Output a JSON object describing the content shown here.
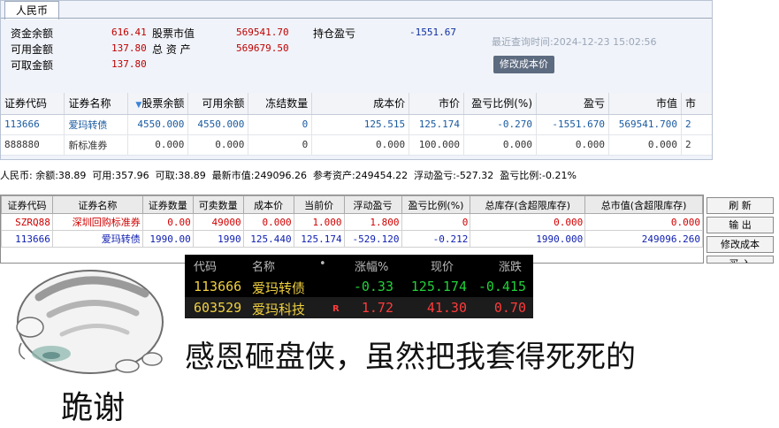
{
  "panel1": {
    "tab": "人民币",
    "summary": {
      "cash_balance": {
        "label": "资金余额",
        "value": "616.41"
      },
      "available": {
        "label": "可用金额",
        "value": "137.80"
      },
      "withdrawable": {
        "label": "可取金额",
        "value": "137.80"
      },
      "stock_value": {
        "label": "股票市值",
        "value": "569541.70"
      },
      "total_assets": {
        "label": "总 资 产",
        "value": "569679.50"
      },
      "position_pnl": {
        "label": "持仓盈亏",
        "value": "-1551.67"
      }
    },
    "last_query": "最近查询时间:2024-12-23 15:02:56",
    "modify_cost_btn": "修改成本价",
    "columns": [
      "证券代码",
      "证券名称",
      "股票余额",
      "可用余额",
      "冻结数量",
      "成本价",
      "市价",
      "盈亏比例(%)",
      "盈亏",
      "市值",
      "市"
    ],
    "rows": [
      [
        "113666",
        "爱玛转债",
        "4550.000",
        "4550.000",
        "0",
        "125.515",
        "125.174",
        "-0.270",
        "-1551.670",
        "569541.700",
        "2"
      ],
      [
        "888880",
        "新标准券",
        "0.000",
        "0.000",
        "0",
        "0.000",
        "100.000",
        "0.000",
        "0.000",
        "0.000",
        "2"
      ]
    ]
  },
  "panel2": {
    "summary": "人民币: 余额:38.89  可用:357.96  可取:38.89  最新市值:249096.26  参考资产:249454.22  浮动盈亏:-527.32  盈亏比例:-0.21%",
    "columns": [
      "证券代码",
      "证券名称",
      "证券数量",
      "可卖数量",
      "成本价",
      "当前价",
      "浮动盈亏",
      "盈亏比例(%)",
      "总库存(含超限库存)",
      "总市值(含超限库存)"
    ],
    "rows": [
      [
        "SZRQ88",
        "深圳回购标准券",
        "0.00",
        "49000",
        "0.000",
        "1.000",
        "1.800",
        "0",
        "0.000",
        "0.000"
      ],
      [
        "113666",
        "爱玛转债",
        "1990.00",
        "1990",
        "125.440",
        "125.174",
        "-529.120",
        "-0.212",
        "1990.000",
        "249096.260"
      ]
    ],
    "buttons": [
      "刷 新",
      "输 出",
      "修改成本",
      "买 入"
    ]
  },
  "quote": {
    "headers": {
      "code": "代码",
      "name": "名称",
      "dot": "•",
      "change_pct": "涨幅%",
      "price": "现价",
      "change": "涨跌"
    },
    "rows": [
      {
        "code": "113666",
        "name": "爱玛转债",
        "flag": "",
        "change_pct": "-0.33",
        "price": "125.174",
        "change": "-0.415"
      },
      {
        "code": "603529",
        "name": "爱玛科技",
        "flag": "R",
        "change_pct": "1.72",
        "price": "41.30",
        "change": "0.70"
      }
    ],
    "colors": {
      "up": "#ff3b3b",
      "down": "#22d03a",
      "code": "#f0d040"
    }
  },
  "meme": {
    "line": "感恩砸盘侠，虽然把我套得死死的",
    "sub": "跪谢",
    "icon": "hamster-icon"
  }
}
